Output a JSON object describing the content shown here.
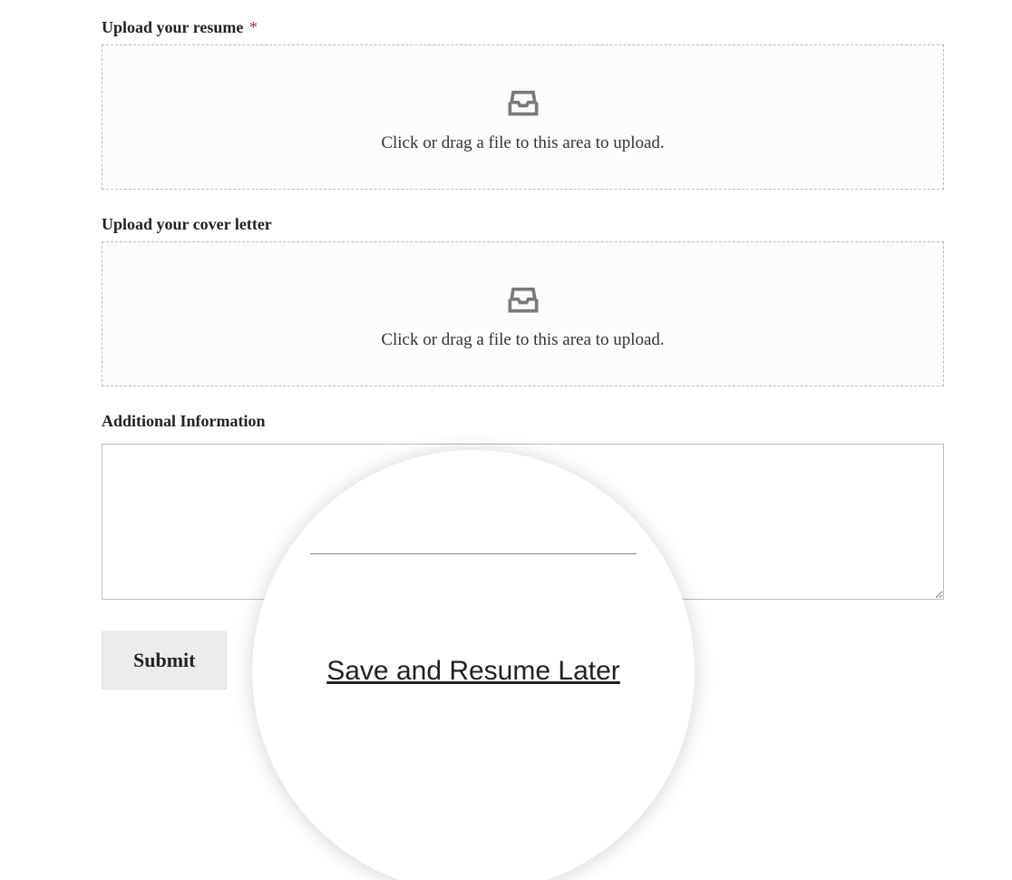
{
  "resume": {
    "label": "Upload your resume",
    "required_mark": "*",
    "dropzone_text": "Click or drag a file to this area to upload."
  },
  "cover_letter": {
    "label": "Upload your cover letter",
    "dropzone_text": "Click or drag a file to this area to upload."
  },
  "additional": {
    "label": "Additional Information",
    "value": ""
  },
  "actions": {
    "submit_label": "Submit",
    "save_resume_link": "Save and Resume Later"
  }
}
